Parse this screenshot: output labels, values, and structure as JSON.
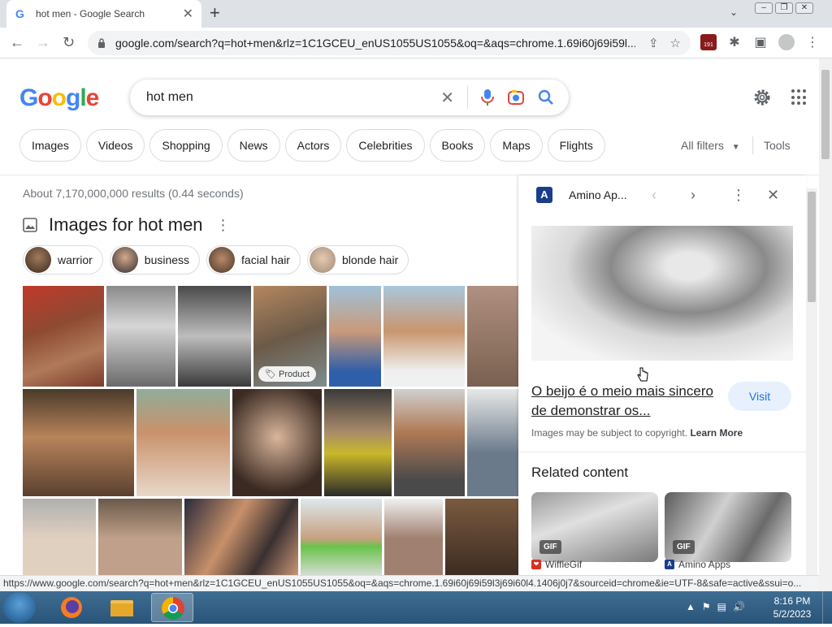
{
  "browser": {
    "tab_title": "hot men - Google Search",
    "url": "google.com/search?q=hot+men&rlz=1C1GCEU_enUS1055US1055&oq=&aqs=chrome.1.69i60j69i59l...",
    "status_url": "https://www.google.com/search?q=hot+men&rlz=1C1GCEU_enUS1055US1055&oq=&aqs=chrome.1.69i60j69i59l3j69i60l4.1406j0j7&sourceid=chrome&ie=UTF-8&safe=active&ssui=o...",
    "extension_badge": "191"
  },
  "search": {
    "query": "hot men",
    "chips": [
      "Images",
      "Videos",
      "Shopping",
      "News",
      "Actors",
      "Celebrities",
      "Books",
      "Maps",
      "Flights"
    ],
    "all_filters": "All filters",
    "tools": "Tools",
    "result_stats": "About 7,170,000,000 results (0.44 seconds)"
  },
  "images_section": {
    "title": "Images for hot men",
    "refinements": [
      "warrior",
      "business",
      "facial hair",
      "blonde hair"
    ],
    "product_badge": "Product"
  },
  "panel": {
    "source": "Amino Ap...",
    "title": "O beijo é o meio mais sincero de demonstrar os...",
    "visit_label": "Visit",
    "copyright": "Images may be subject to copyright.",
    "learn_more": "Learn More",
    "related_heading": "Related content",
    "related": [
      {
        "badge": "GIF",
        "source": "WiffleGif"
      },
      {
        "badge": "GIF",
        "source": "Amino Apps"
      }
    ]
  },
  "taskbar": {
    "time": "8:16 PM",
    "date": "5/2/2023"
  }
}
